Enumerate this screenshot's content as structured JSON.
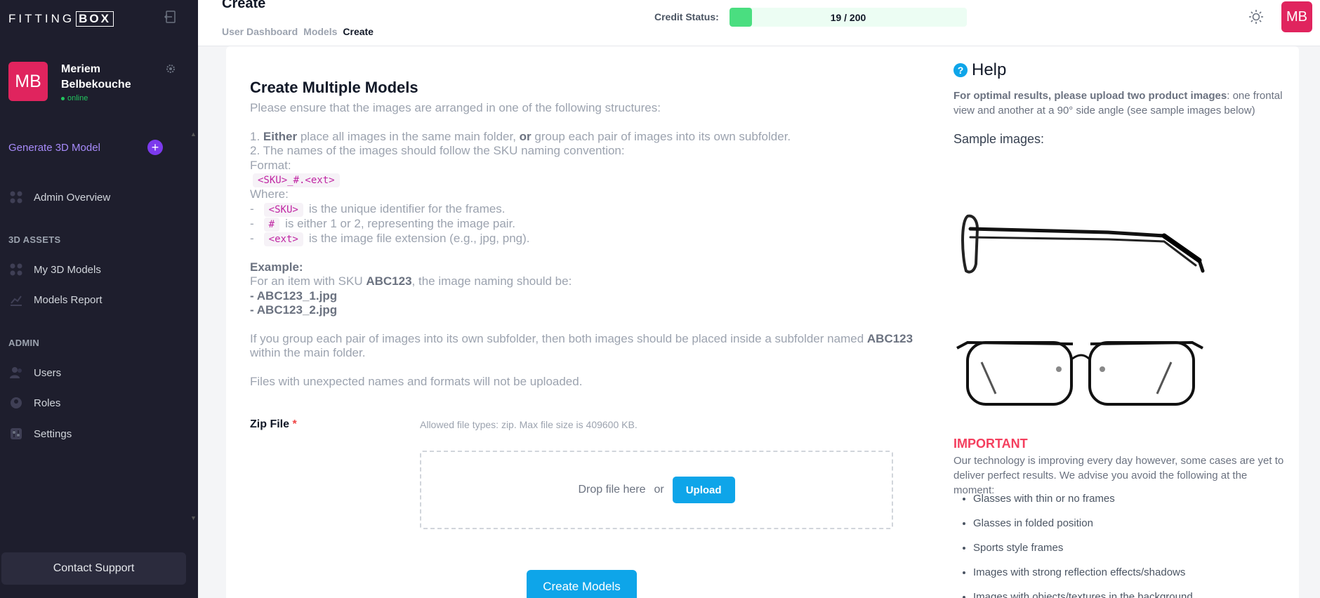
{
  "sidebar": {
    "logo_text": "FITTING",
    "logo_box": "BOX",
    "user": {
      "initials": "MB",
      "name": "Meriem Belbekouche",
      "status": "online"
    },
    "generate_label": "Generate 3D Model",
    "nav_admin_overview": "Admin Overview",
    "section_assets": "3D ASSETS",
    "nav_my_models": "My 3D Models",
    "nav_models_report": "Models Report",
    "section_admin": "ADMIN",
    "nav_users": "Users",
    "nav_roles": "Roles",
    "nav_settings": "Settings",
    "contact_support": "Contact Support"
  },
  "header": {
    "title": "Create",
    "breadcrumb": [
      "User Dashboard",
      "Models",
      "Create"
    ],
    "credit_label": "Credit Status:",
    "credit_text": "19 / 200",
    "credit_used": 19,
    "credit_total": 200,
    "avatar_initials": "MB"
  },
  "main": {
    "heading": "Create Multiple Models",
    "intro": "Please ensure that the images are arranged in one of the following structures:",
    "rule1_pre": "1. ",
    "rule1_either": "Either",
    "rule1_mid": " place all images in the same main folder, ",
    "rule1_or": "or",
    "rule1_post": " group each pair of images into its own subfolder.",
    "rule2": "2. The names of the images should follow the SKU naming convention:",
    "format_label": "Format:",
    "format_code": "<SKU>_#.<ext>",
    "where_label": "Where:",
    "where_items": [
      {
        "dash": "-",
        "code": "<SKU>",
        "text": "is the unique identifier for the frames."
      },
      {
        "dash": "-",
        "code": "#",
        "text": "is either 1 or 2, representing the image pair."
      },
      {
        "dash": "-",
        "code": "<ext>",
        "text": "is the image file extension (e.g., jpg, png)."
      }
    ],
    "example_label": "Example:",
    "example_pre": "For an item with SKU ",
    "example_sku": "ABC123",
    "example_post": ", the image naming should be:",
    "example_file1_dash": "- ",
    "example_file1": "ABC123_1.jpg",
    "example_file2_dash": "- ",
    "example_file2": "ABC123_2.jpg",
    "subfolder_pre": "If you group each pair of images into its own subfolder, then both images should be placed inside a subfolder named ",
    "subfolder_name": "ABC123",
    "subfolder_post": " within the main folder.",
    "warning": "Files with unexpected names and formats will not be uploaded.",
    "zip_label": "Zip File",
    "zip_required": "*",
    "zip_hint": "Allowed file types: zip. Max file size is 409600 KB.",
    "drop_text": "Drop file here",
    "drop_or": "or",
    "upload_label": "Upload",
    "create_label": "Create Models"
  },
  "help": {
    "title": "Help",
    "intro_bold": "For optimal results, please upload two product images",
    "intro_rest": ": one frontal view and another at a 90° side angle (see sample images below)",
    "sample_label": "Sample images:",
    "important_label": "IMPORTANT",
    "important_text": "Our technology is improving every day however, some cases are yet to deliver perfect results. We advise you avoid the following at the moment:",
    "avoid_items": [
      "Glasses with thin or no frames",
      "Glasses in folded position",
      "Sports style frames",
      "Images with strong reflection effects/shadows",
      "Images with objects/textures in the background"
    ]
  },
  "colors": {
    "sidebar_bg": "#1e1e2d",
    "accent": "#0ea5e9",
    "avatar": "#e0245e",
    "credit_fill": "#4ade80",
    "important": "#f43f5e"
  }
}
